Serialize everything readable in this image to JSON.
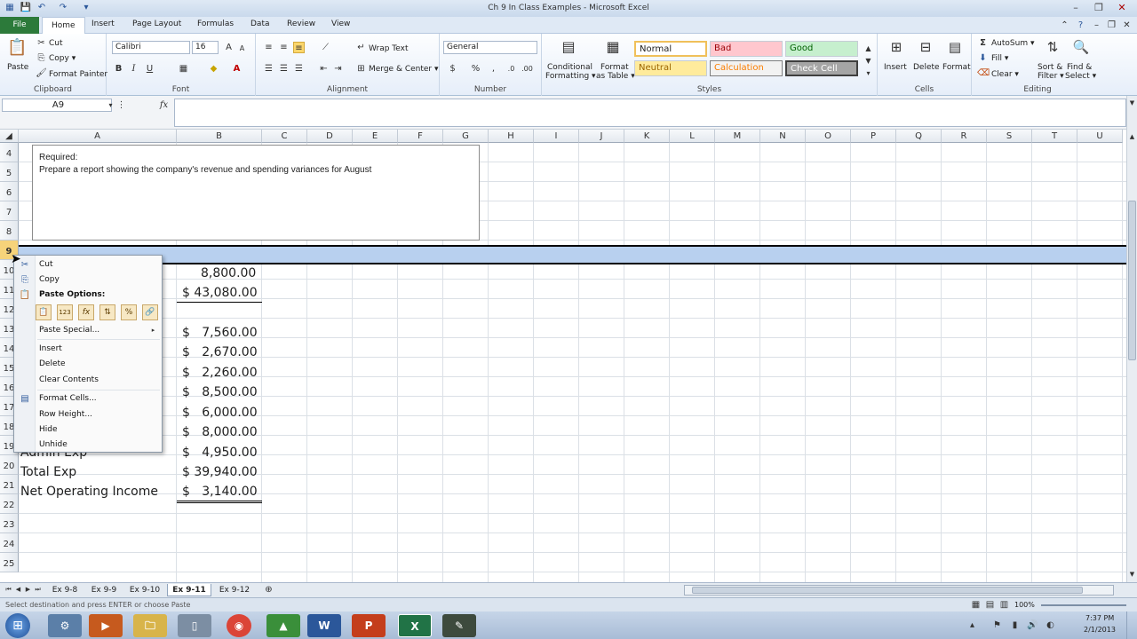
{
  "window": {
    "title": "Ch 9 In Class Examples - Microsoft Excel"
  },
  "tabs": [
    "File",
    "Home",
    "Insert",
    "Page Layout",
    "Formulas",
    "Data",
    "Review",
    "View"
  ],
  "ribbon": {
    "clipboard": {
      "label": "Clipboard",
      "paste": "Paste",
      "cut": "Cut",
      "copy": "Copy ▾",
      "format_painter": "Format Painter"
    },
    "font": {
      "label": "Font",
      "name": "Calibri",
      "size": "16"
    },
    "alignment": {
      "label": "Alignment",
      "wrap": "Wrap Text",
      "merge": "Merge & Center ▾"
    },
    "number": {
      "label": "Number",
      "format": "General"
    },
    "styles": {
      "label": "Styles",
      "conditional_1": "Conditional",
      "conditional_2": "Formatting ▾",
      "format_table_1": "Format",
      "format_table_2": "as Table ▾",
      "normal": "Normal",
      "bad": "Bad",
      "good": "Good",
      "neutral": "Neutral",
      "calculation": "Calculation",
      "check_cell": "Check Cell"
    },
    "cells": {
      "label": "Cells",
      "insert": "Insert",
      "delete": "Delete",
      "format": "Format"
    },
    "editing": {
      "label": "Editing",
      "autosum": "AutoSum ▾",
      "fill": "Fill ▾",
      "clear": "Clear ▾",
      "sort_1": "Sort &",
      "sort_2": "Filter ▾",
      "find_1": "Find &",
      "find_2": "Select ▾"
    }
  },
  "formula_bar": {
    "name_box": "A9",
    "fx": "fx",
    "value": ""
  },
  "columns": [
    "A",
    "B",
    "C",
    "D",
    "E",
    "F",
    "G",
    "H",
    "I",
    "J",
    "K",
    "L",
    "M",
    "N",
    "O",
    "P",
    "Q",
    "R",
    "S",
    "T",
    "U"
  ],
  "rows": [
    "4",
    "5",
    "6",
    "7",
    "8",
    "9",
    "10",
    "11",
    "12",
    "13",
    "14",
    "15",
    "16",
    "17",
    "18",
    "19",
    "20",
    "21",
    "22",
    "23",
    "24",
    "25"
  ],
  "textbox": {
    "heading": "Required:",
    "body": "Prepare a report showing the company's revenue and spending variances for  August"
  },
  "cells": {
    "b10": "8,800.00",
    "b11": "$ 43,080.00",
    "b13": "$   7,560.00",
    "b14": "$   2,670.00",
    "b15": "$   2,260.00",
    "b16": "$   8,500.00",
    "b17": "$   6,000.00",
    "b18": "$   8,000.00",
    "a19": "Admin Exp",
    "b19": "$   4,950.00",
    "a20": "Total Exp",
    "b20": "$ 39,940.00",
    "a21": "Net Operating Income",
    "b21": "$   3,140.00"
  },
  "context_menu": {
    "cut": "Cut",
    "copy": "Copy",
    "paste_options": "Paste Options:",
    "paste_icons": [
      "📋",
      "123",
      "fx",
      "⇅",
      "%",
      "🔗"
    ],
    "paste_special": "Paste Special...",
    "insert": "Insert",
    "delete": "Delete",
    "clear_contents": "Clear Contents",
    "format_cells": "Format Cells...",
    "row_height": "Row Height...",
    "hide": "Hide",
    "unhide": "Unhide"
  },
  "sheets": [
    "Ex 9-8",
    "Ex 9-9",
    "Ex 9-10",
    "Ex 9-11",
    "Ex 9-12"
  ],
  "active_sheet": "Ex 9-11",
  "status": {
    "message": "Select destination and press ENTER or choose Paste",
    "zoom": "100%"
  },
  "taskbar": {
    "time": "7:37 PM",
    "date": "2/1/2013"
  }
}
